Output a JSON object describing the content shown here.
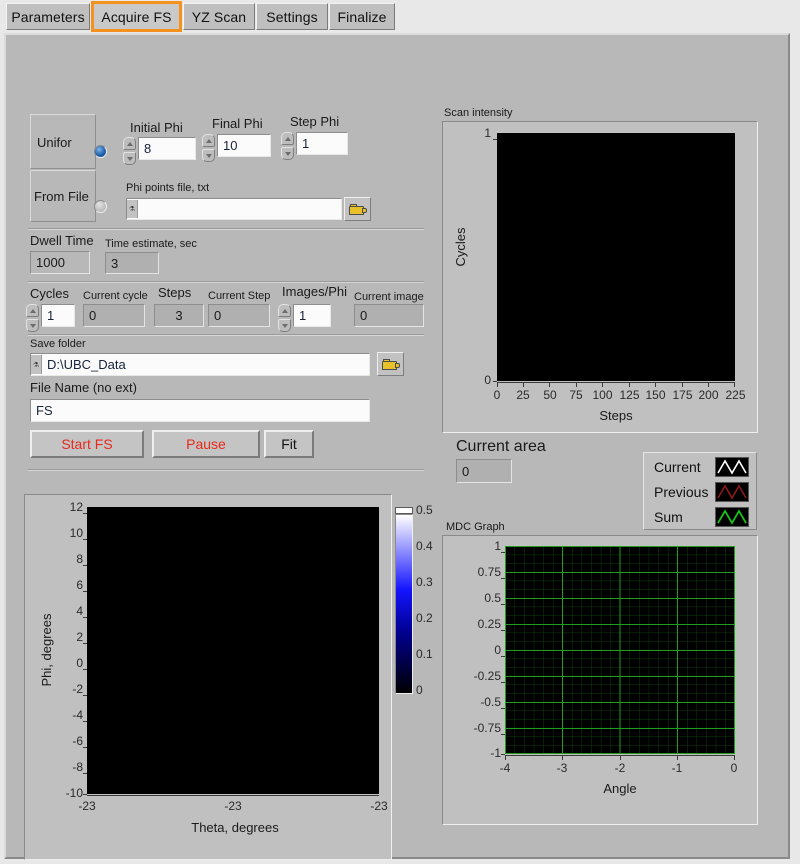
{
  "window": {
    "title": "Acquire FS"
  },
  "tabs": [
    {
      "label": "Parameters",
      "selected": false
    },
    {
      "label": "Acquire FS",
      "selected": true
    },
    {
      "label": "YZ Scan",
      "selected": false
    },
    {
      "label": "Settings",
      "selected": false
    },
    {
      "label": "Finalize",
      "selected": false
    }
  ],
  "phi_mode": {
    "uniform_label": "Unifor",
    "uniform_selected": true,
    "from_file_label": "From File",
    "from_file_selected": false
  },
  "phi_fields": {
    "initial_label": "Initial Phi",
    "initial_value": "8",
    "final_label": "Final Phi",
    "final_value": "10",
    "step_label": "Step Phi",
    "step_value": "1"
  },
  "phi_file": {
    "label": "Phi points file, txt",
    "value": "",
    "browse_icon": "folder-icon"
  },
  "timing": {
    "dwell_label": "Dwell Time",
    "dwell_value": "1000",
    "estimate_label": "Time estimate, sec",
    "estimate_value": "3"
  },
  "counters": {
    "cycles_label": "Cycles",
    "cycles_value": "1",
    "current_cycle_label": "Current cycle",
    "current_cycle_value": "0",
    "steps_label": "Steps",
    "steps_value": "3",
    "current_step_label": "Current Step",
    "current_step_value": "0",
    "images_per_phi_label": "Images/Phi",
    "images_per_phi_value": "1",
    "current_image_label": "Current image",
    "current_image_value": "0"
  },
  "save": {
    "folder_label": "Save folder",
    "folder_value": "D:\\UBC_Data",
    "folder_browse_icon": "folder-icon",
    "filename_label": "File Name (no ext)",
    "filename_value": "FS"
  },
  "actions": {
    "start_label": "Start FS",
    "pause_label": "Pause",
    "fit_label": "Fit",
    "start_color": "#e8291c",
    "pause_color": "#e8291c",
    "fit_color": "#111111"
  },
  "current_area": {
    "label": "Current area",
    "value": "0"
  },
  "legend": {
    "items": [
      {
        "name": "Current",
        "color": "#ffffff"
      },
      {
        "name": "Previous",
        "color": "#8b1a1a"
      },
      {
        "name": "Sum",
        "color": "#18c218"
      }
    ]
  },
  "colorbar": {
    "ticks": [
      "0.5",
      "0.4",
      "0.3",
      "0.2",
      "0.1",
      "0"
    ],
    "min": 0,
    "max": 0.5,
    "gradient": [
      "#000000",
      "#0000a0",
      "#2020ff",
      "#a0a0ff",
      "#ffffff"
    ]
  },
  "chart_data": [
    {
      "type": "heatmap",
      "name": "scan-intensity-graph",
      "title": "Scan intensity",
      "xlabel": "Steps",
      "ylabel": "Cycles",
      "xticks": [
        "0",
        "25",
        "50",
        "75",
        "100",
        "125",
        "150",
        "175",
        "200",
        "225"
      ],
      "yticks": [
        "1",
        "0"
      ],
      "xlim": [
        0,
        225
      ],
      "ylim": [
        0,
        1
      ],
      "grid": false,
      "background": "#000000",
      "values": []
    },
    {
      "type": "heatmap",
      "name": "theta-phi-map",
      "title": "",
      "xlabel": "Theta, degrees",
      "ylabel": "Phi, degrees",
      "xticks": [
        "-23",
        "-23",
        "-23"
      ],
      "yticks": [
        "12",
        "10",
        "8",
        "6",
        "4",
        "2",
        "0",
        "-2",
        "-4",
        "-6",
        "-8",
        "-10"
      ],
      "xlim": [
        -23,
        -23
      ],
      "ylim": [
        -10,
        12
      ],
      "grid": false,
      "background": "#000000",
      "values": []
    },
    {
      "type": "line",
      "name": "mdc-graph",
      "title": "MDC Graph",
      "xlabel": "Angle",
      "ylabel": "",
      "xticks": [
        "-4",
        "-3",
        "-2",
        "-1",
        "0"
      ],
      "yticks": [
        "1",
        "0.75",
        "0.5",
        "0.25",
        "0",
        "-0.25",
        "-0.5",
        "-0.75",
        "-1"
      ],
      "xlim": [
        -4,
        0
      ],
      "ylim": [
        -1,
        1
      ],
      "grid": true,
      "grid_color": "#1f9d1f",
      "background": "#000000",
      "series": [
        {
          "name": "Current",
          "color": "#ffffff",
          "values": []
        },
        {
          "name": "Previous",
          "color": "#8b1a1a",
          "values": []
        },
        {
          "name": "Sum",
          "color": "#18c218",
          "values": []
        }
      ]
    }
  ]
}
